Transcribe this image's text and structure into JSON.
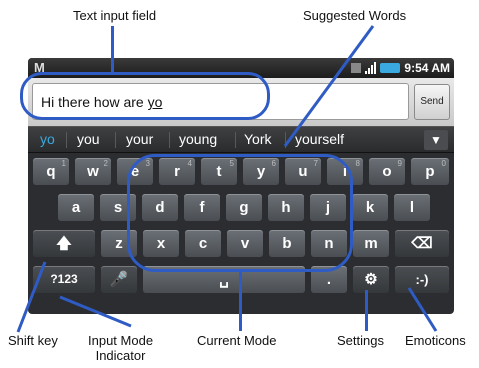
{
  "callouts": {
    "text_input": "Text input field",
    "suggested": "Suggested Words",
    "shift": "Shift key",
    "input_mode_1": "Input Mode",
    "input_mode_2": "Indicator",
    "current_mode": "Current Mode",
    "settings": "Settings",
    "emoticons": "Emoticons"
  },
  "status": {
    "left": "M",
    "time": "9:54 AM"
  },
  "input": {
    "prefix": "Hi there how are ",
    "underlined": "yo"
  },
  "send_label": "Send",
  "suggestions": [
    "yo",
    "you",
    "your",
    "young",
    "York",
    "yourself"
  ],
  "rows": {
    "row1": [
      {
        "k": "q",
        "s": "1"
      },
      {
        "k": "w",
        "s": "2"
      },
      {
        "k": "e",
        "s": "3"
      },
      {
        "k": "r",
        "s": "4"
      },
      {
        "k": "t",
        "s": "5"
      },
      {
        "k": "y",
        "s": "6"
      },
      {
        "k": "u",
        "s": "7"
      },
      {
        "k": "i",
        "s": "8"
      },
      {
        "k": "o",
        "s": "9"
      },
      {
        "k": "p",
        "s": "0"
      }
    ],
    "row2": [
      "a",
      "s",
      "d",
      "f",
      "g",
      "h",
      "j",
      "k",
      "l"
    ],
    "row3": [
      "z",
      "x",
      "c",
      "v",
      "b",
      "n",
      "m"
    ]
  },
  "keys": {
    "symbols": "?123",
    "period": ".",
    "emoticon": ":-)"
  },
  "colors": {
    "accent": "#2f5cc4",
    "suggest_selected": "#39a9e0"
  }
}
